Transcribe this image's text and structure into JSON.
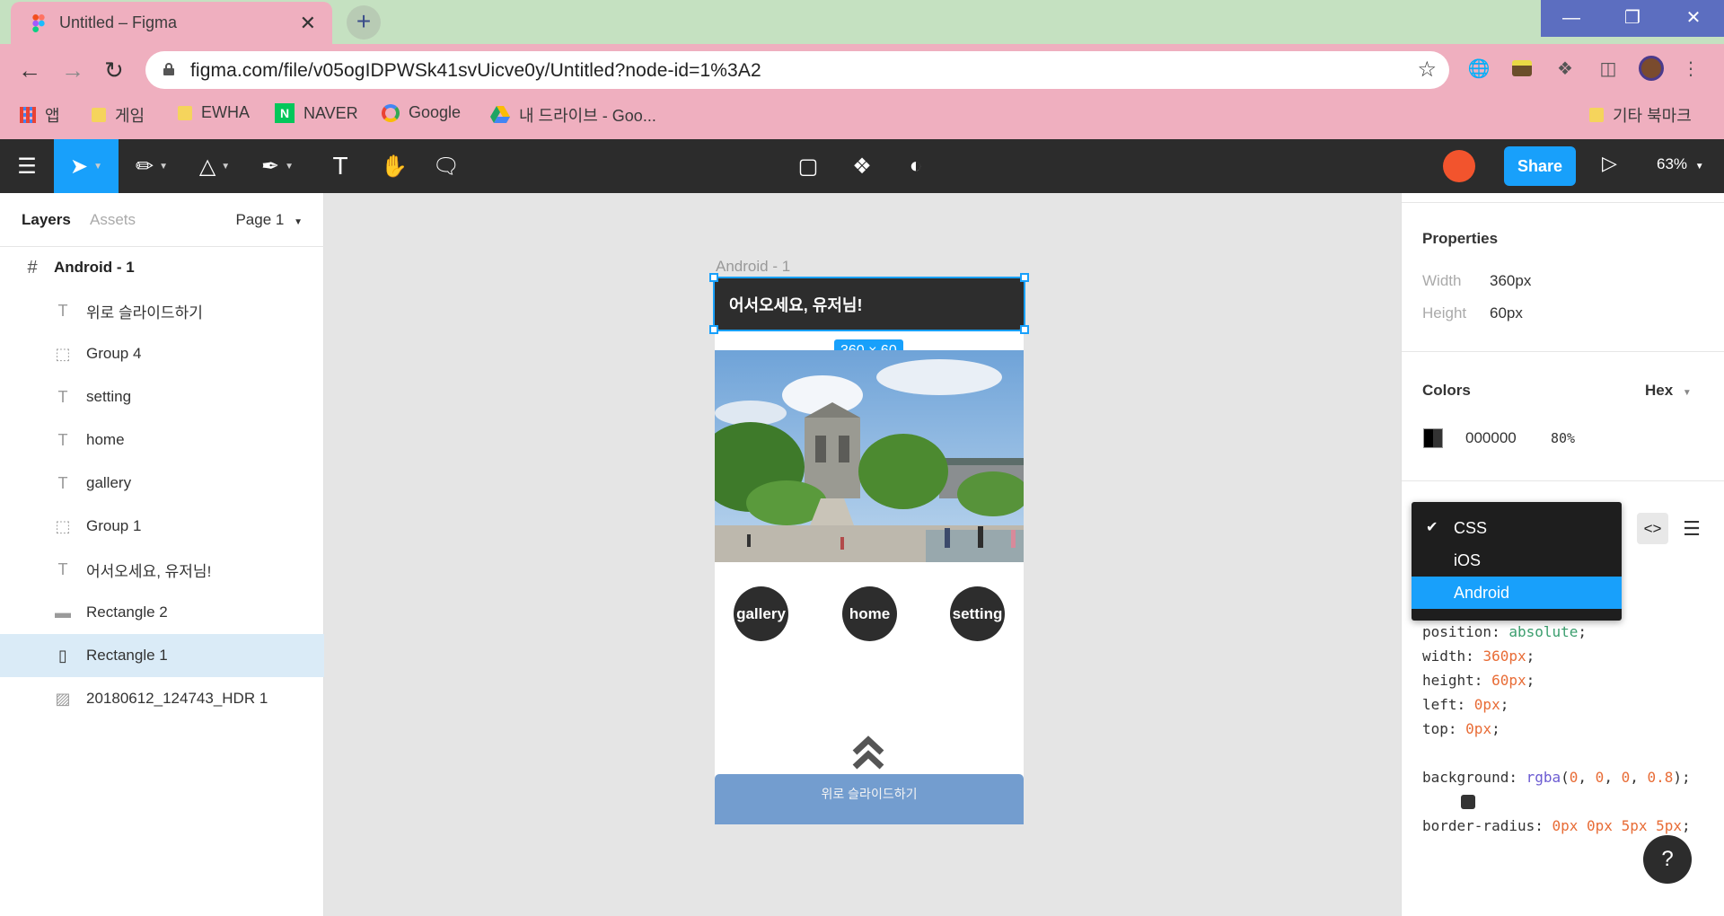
{
  "browser": {
    "tab_title": "Untitled – Figma",
    "close_glyph": "✕",
    "new_tab_glyph": "+",
    "url": "figma.com/file/v05ogIDPWSk41svUicve0y/Untitled?node-id=1%3A2",
    "window_buttons": [
      "—",
      "❐",
      "✕"
    ],
    "bookmarks": [
      {
        "label": "앱",
        "icon": "apps-grid-icon"
      },
      {
        "label": "게임",
        "icon": "folder-icon"
      },
      {
        "label": "EWHA",
        "icon": "folder-icon"
      },
      {
        "label": "NAVER",
        "icon": "naver-icon"
      },
      {
        "label": "Google",
        "icon": "google-icon"
      },
      {
        "label": "내 드라이브 - Goo...",
        "icon": "drive-icon"
      }
    ],
    "other_bookmarks": "기타 북마크"
  },
  "figma_toolbar": {
    "share_label": "Share",
    "zoom_label": "63%",
    "text_tool_glyph": "T"
  },
  "left_panel": {
    "tabs": [
      "Layers",
      "Assets"
    ],
    "page_label": "Page 1",
    "layers": [
      {
        "name": "Android - 1",
        "icon": "frame-icon",
        "glyph": "#"
      },
      {
        "name": "위로 슬라이드하기",
        "icon": "text-icon",
        "glyph": "T"
      },
      {
        "name": "Group 4",
        "icon": "group-icon",
        "glyph": "⬚"
      },
      {
        "name": "setting",
        "icon": "text-icon",
        "glyph": "T"
      },
      {
        "name": "home",
        "icon": "text-icon",
        "glyph": "T"
      },
      {
        "name": "gallery",
        "icon": "text-icon",
        "glyph": "T"
      },
      {
        "name": "Group 1",
        "icon": "group-icon",
        "glyph": "⬚"
      },
      {
        "name": "어서오세요, 유저님!",
        "icon": "text-icon",
        "glyph": "T"
      },
      {
        "name": "Rectangle 2",
        "icon": "rectangle-icon",
        "glyph": "▬"
      },
      {
        "name": "Rectangle 1",
        "icon": "rectangle-icon",
        "glyph": "▯"
      },
      {
        "name": "20180612_124743_HDR 1",
        "icon": "image-icon",
        "glyph": "▨"
      }
    ],
    "selected_layer": "Rectangle 1"
  },
  "canvas": {
    "frame_label": "Android - 1",
    "header_text": "어서오세요, 유저님!",
    "selection_size": "360 × 60",
    "nav_buttons": [
      "gallery",
      "home",
      "setting"
    ],
    "bottom_bar_text": "위로 슬라이드하기"
  },
  "right_panel": {
    "properties_title": "Properties",
    "width_label": "Width",
    "width_value": "360px",
    "height_label": "Height",
    "height_value": "60px",
    "colors_title": "Colors",
    "color_format": "Hex",
    "color_hex": "000000",
    "color_opacity": "80%",
    "code_languages": [
      "CSS",
      "iOS",
      "Android"
    ],
    "selected_language": "CSS",
    "highlighted_language": "Android",
    "code": {
      "position": {
        "prop": "position",
        "value": "absolute"
      },
      "width": {
        "prop": "width",
        "value": "360px"
      },
      "height": {
        "prop": "height",
        "value": "60px"
      },
      "left": {
        "prop": "left",
        "value": "0px"
      },
      "top": {
        "prop": "top",
        "value": "0px"
      },
      "background": {
        "prop": "background",
        "fn": "rgba",
        "args": [
          "0",
          "0",
          "0",
          "0.8"
        ]
      },
      "border_radius": {
        "prop": "border-radius",
        "value": "0px 0px 5px 5px"
      }
    },
    "help_label": "?"
  },
  "colors": {
    "figma_blue": "#18a0fb",
    "toolbar_dark": "#2c2c2c",
    "chrome_pink": "#efafbf",
    "bottom_bar": "#739dcf"
  }
}
